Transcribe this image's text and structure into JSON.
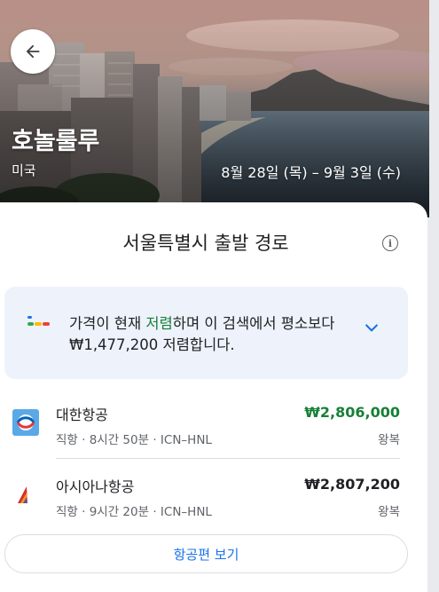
{
  "destination": {
    "city": "호놀룰루",
    "country": "미국",
    "dates": "8월 28일 (목) – 9월 3일 (수)"
  },
  "section": {
    "title": "서울특별시 출발 경로"
  },
  "insight": {
    "prefix": "가격이 현재 ",
    "highlight": "저렴",
    "suffix": "하며 이 검색에서 평소보다 ₩1,477,200 저렴합니다."
  },
  "flights": [
    {
      "airline": "대한항공",
      "route": "직항 · 8시간 50분 · ICN–HNL",
      "price": "₩2,806,000",
      "trip": "왕복",
      "price_color": "#188038"
    },
    {
      "airline": "아시아나항공",
      "route": "직항 · 9시간 20분 · ICN–HNL",
      "price": "₩2,807,200",
      "trip": "왕복",
      "price_color": "#202124"
    }
  ],
  "actions": {
    "view_flights": "항공편 보기"
  },
  "icons": {
    "back": "arrow-left-icon",
    "info": "info-icon",
    "trend": "price-trend-icon",
    "expand": "chevron-down-icon"
  },
  "colors": {
    "accent": "#1a73e8",
    "low_price": "#188038",
    "insight_bg": "#eef3fb"
  }
}
